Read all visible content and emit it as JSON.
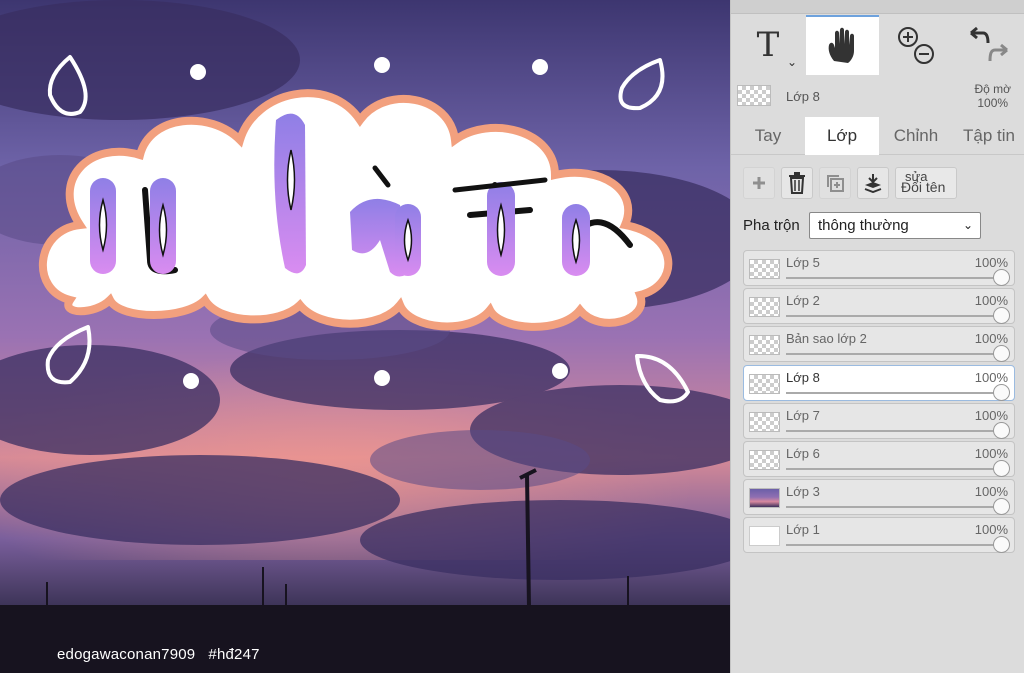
{
  "canvas": {
    "watermark": "edogawaconan7909   #hđ247",
    "lettering": "ụ làm tr"
  },
  "toolbar": {
    "text_tool_icon": "T",
    "text_tool_caret": "⌄",
    "hand_tool": "hand-icon",
    "zoom_tools": "zoom-in-out-icon",
    "undo_redo": "undo-redo-icon"
  },
  "current_layer": {
    "name": "Lớp 8",
    "opacity_label": "Độ mờ",
    "opacity_value": "100%"
  },
  "tabs": [
    {
      "label": "Tay",
      "active": false
    },
    {
      "label": "Lớp",
      "active": true
    },
    {
      "label": "Chỉnh",
      "active": false
    },
    {
      "label": "Tập tin",
      "active": false
    }
  ],
  "layer_actions": {
    "rename_top": "sửa",
    "rename_bottom": "Đổi tên"
  },
  "blend": {
    "label": "Pha trộn",
    "value": "thông thường",
    "arrow": "⌄"
  },
  "layers": [
    {
      "name": "Lớp 5",
      "opacity": "100%",
      "thumb": "transparent",
      "selected": false
    },
    {
      "name": "Lớp 2",
      "opacity": "100%",
      "thumb": "transparent",
      "selected": false
    },
    {
      "name": "Bản sao lớp 2",
      "opacity": "100%",
      "thumb": "transparent",
      "selected": false
    },
    {
      "name": "Lớp 8",
      "opacity": "100%",
      "thumb": "transparent",
      "selected": true
    },
    {
      "name": "Lớp 7",
      "opacity": "100%",
      "thumb": "transparent",
      "selected": false
    },
    {
      "name": "Lớp 6",
      "opacity": "100%",
      "thumb": "transparent",
      "selected": false
    },
    {
      "name": "Lớp 3",
      "opacity": "100%",
      "thumb": "photo",
      "selected": false
    },
    {
      "name": "Lớp 1",
      "opacity": "100%",
      "thumb": "white",
      "selected": false
    }
  ],
  "colors": {
    "accent": "#6ea2dd",
    "cloud_outline": "#f2a07e",
    "letter_purple": "#b07cf0"
  }
}
